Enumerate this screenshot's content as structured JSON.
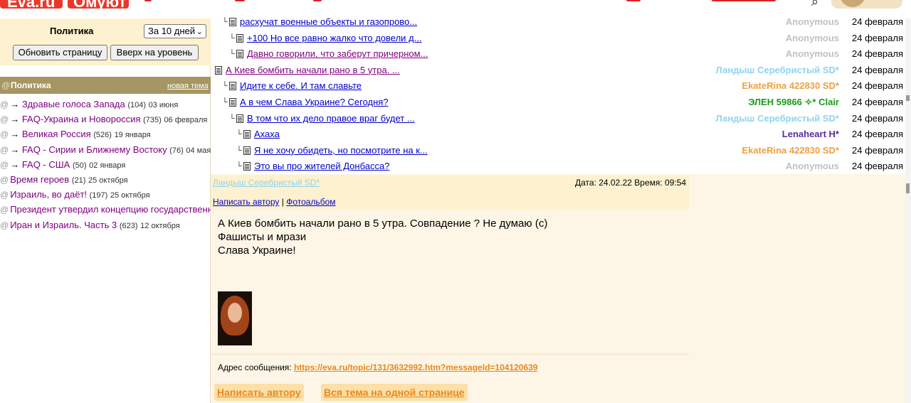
{
  "header": {
    "logo_left": "Eva.ru",
    "logo_right": "Омуют"
  },
  "sidebar": {
    "title": "Политика",
    "period_select": "За 10 дней",
    "refresh_button": "Обновить страницу",
    "up_button": "Вверх на уровень",
    "section": {
      "at": "@",
      "name": "Политика",
      "new_topic": "новая тема"
    },
    "items": [
      {
        "at": "@",
        "arrow": "→ ",
        "name": "Здравые голоса Запада",
        "count": "(104)",
        "date": "03 июня"
      },
      {
        "at": "@",
        "arrow": "→ ",
        "name": "FAQ-Украина и Новороссия",
        "count": "(735)",
        "date": "06 февраля"
      },
      {
        "at": "@",
        "arrow": "→ ",
        "name": "Великая Россия",
        "count": "(526)",
        "date": "19 января"
      },
      {
        "at": "@",
        "arrow": "→ ",
        "name": "FAQ - Сирии и Ближнему Востоку",
        "count": "(76)",
        "date": "04 мая"
      },
      {
        "at": "@",
        "arrow": "→ ",
        "name": "FAQ - США",
        "count": "(50)",
        "date": "02 января"
      },
      {
        "at": "@",
        "arrow": "",
        "name": "Время героев",
        "count": "(21)",
        "date": "25 октября"
      },
      {
        "at": "@",
        "arrow": "",
        "name": "Израиль, во даёт!",
        "count": "(197)",
        "date": "25 октября"
      },
      {
        "at": "@",
        "arrow": "",
        "name": "Президент утвердил концепцию государственн",
        "count": "",
        "date": ""
      },
      {
        "at": "@",
        "arrow": "",
        "name": "Иран и Израиль. Часть 3",
        "count": "(623)",
        "date": "12 октября"
      }
    ]
  },
  "tree": {
    "rows": [
      {
        "subject": "расхучат военные объекты и газопрово...",
        "author": "Anonymous",
        "date": "24 февраля"
      },
      {
        "subject": "+100 Но все равно жалко что довели д...",
        "author": "Anonymous",
        "date": "24 февраля"
      },
      {
        "subject": "Давно говорили, что заберут причерном...",
        "author": "Anonymous",
        "date": "24 февраля"
      },
      {
        "subject": "А Киев бомбить начали рано в 5 утра. ...",
        "author": "Ландыш Серебристый SD*",
        "date": "24 февраля"
      },
      {
        "subject": "Идите к себе. И там славьте",
        "author": "EkateRina 422830 SD*",
        "date": "24 февраля"
      },
      {
        "subject": "А в чем Слава Украине? Сегодня?",
        "author": "ЭЛЕН 59866 ✧* Clair",
        "date": "24 февраля"
      },
      {
        "subject": "В том что их дело правое враг будет ...",
        "author": "Ландыш Серебристый SD*",
        "date": "24 февраля"
      },
      {
        "subject": "Ахаха",
        "author": "Lenaheart H*",
        "date": "24 февраля"
      },
      {
        "subject": "Я не хочу обидеть, но посмотрите на к...",
        "author": "EkateRina 422830 SD*",
        "date": "24 февраля"
      },
      {
        "subject": "Это вы про жителей Донбасса?",
        "author": "Anonymous",
        "date": "24 февраля"
      }
    ]
  },
  "message": {
    "author": "Ландыш Серебристый SD*",
    "date_label": "Дата: 24.02.22 Время: 09:54",
    "write_author": "Написать автору",
    "separator": " | ",
    "photoalbum": "Фотоальбом",
    "body_lines": [
      "А Киев бомбить начали рано в 5 утра. Совпадение ? Не думаю (с)",
      "Фашисты и мрази",
      "Слава Украине!"
    ],
    "address_label": "Адрес сообщения: ",
    "address_url": "https://eva.ru/topic/131/3632992.htm?messageId=104120639",
    "bottom_write_author": "Написать автору",
    "bottom_whole_topic": "Вся тема на одной странице"
  },
  "colors": {
    "anonymous": "#c0c0c0",
    "landysh": "#8fd3f1",
    "ekaterina": "#f0a040",
    "elen": "#1a9a1a",
    "lenaheart": "#5b2d9e",
    "visited": "#800080",
    "link": "#0000cc"
  }
}
